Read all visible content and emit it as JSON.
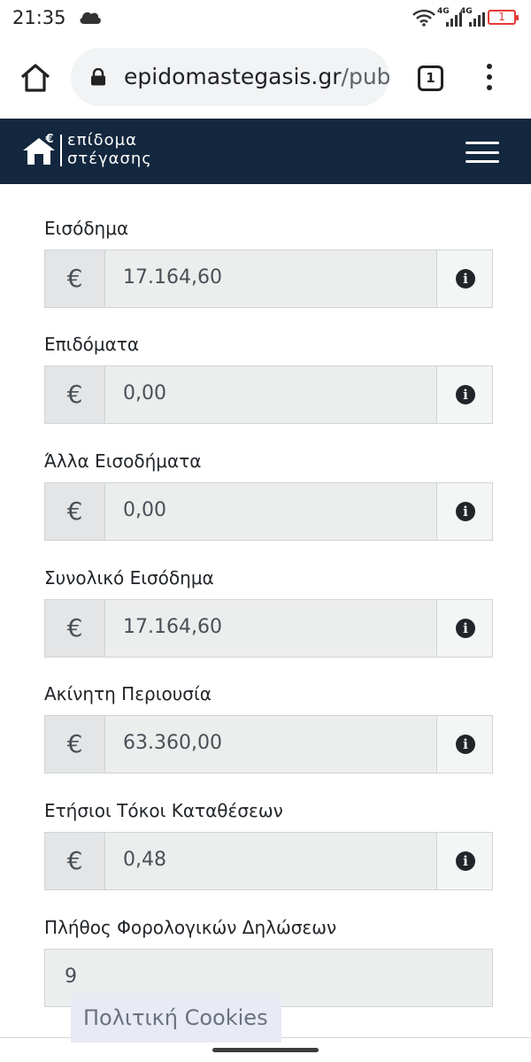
{
  "status_bar": {
    "time": "21:35",
    "network_1": "4G",
    "network_2": "4G",
    "battery_level": "1",
    "battery_color": "#e53935"
  },
  "browser": {
    "url_host": "epidomastegasis.gr",
    "url_path": "/pub",
    "tab_count": "1",
    "icons": [
      "home-icon",
      "lock-icon",
      "tabs-icon",
      "more-vert-icon"
    ]
  },
  "site_header": {
    "logo_line1": "επίδομα",
    "logo_line2": "στέγασης",
    "background": "#13273e",
    "icons": [
      "house-euro-logo-icon",
      "hamburger-menu-icon"
    ]
  },
  "form": {
    "currency_symbol": "€",
    "info_glyph": "i",
    "fields": [
      {
        "label": "Εισόδημα",
        "value": "17.164,60"
      },
      {
        "label": "Επιδόματα",
        "value": "0,00"
      },
      {
        "label": "Άλλα Εισοδήματα",
        "value": "0,00"
      },
      {
        "label": "Συνολικό Εισόδημα",
        "value": "17.164,60"
      },
      {
        "label": "Ακίνητη Περιουσία",
        "value": "63.360,00"
      },
      {
        "label": "Ετήσιοι Τόκοι Καταθέσεων",
        "value": "0,48"
      },
      {
        "label": "Πλήθος Φορολογικών Δηλώσεων",
        "value": "9"
      }
    ]
  },
  "cookie_banner": {
    "label": "Πολιτική Cookies"
  }
}
